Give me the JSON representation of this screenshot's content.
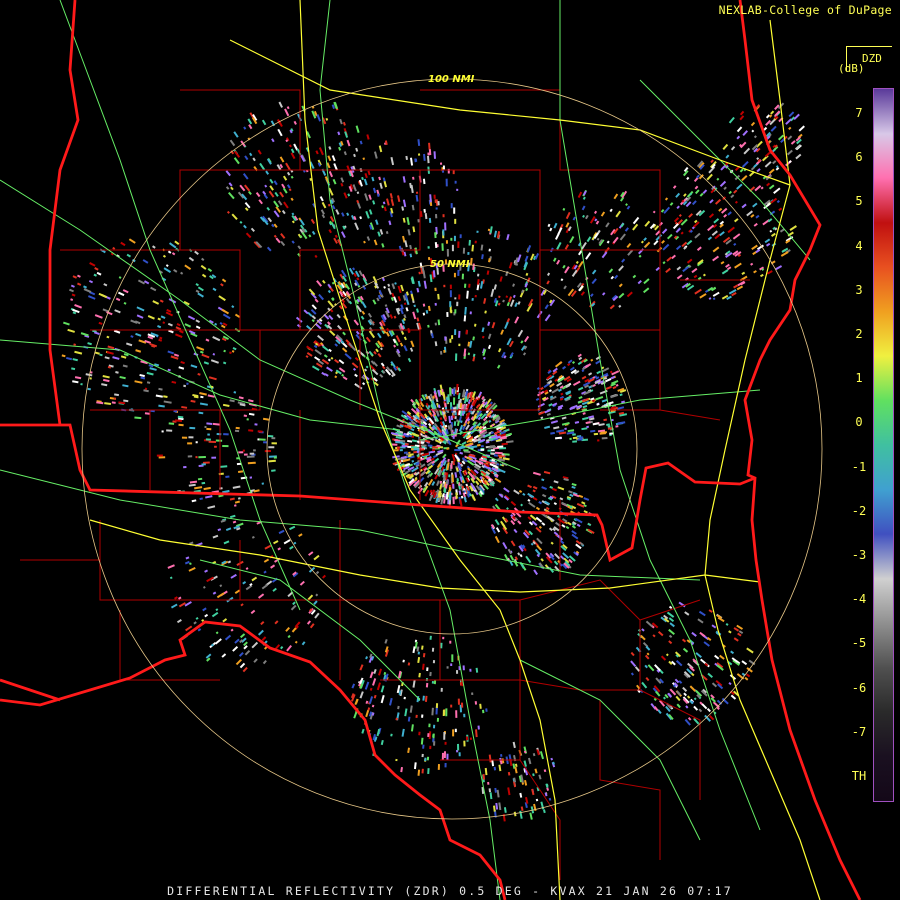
{
  "header": {
    "credit": "NEXLAB-College of DuPage"
  },
  "footer": {
    "product_line": "DIFFERENTIAL REFLECTIVITY (ZDR) 0.5 DEG - KVAX 21 JAN 26 07:17"
  },
  "map": {
    "radar_site": "KVAX",
    "range_rings": [
      {
        "label": "50 NMI"
      },
      {
        "label": "100 NMI"
      }
    ],
    "colors": {
      "state_borders": "#ff1a1a",
      "county_borders": "#b00000",
      "interstates": "#ffff33",
      "highways": "#66ee66",
      "range_rings": "#e8c888",
      "echo_palette": [
        "#7f7f7f",
        "#c8c8c8",
        "#3fb0d0",
        "#3050c8",
        "#40d0a0",
        "#60e060",
        "#e0e040",
        "#f0a020",
        "#e03020",
        "#c00000",
        "#ff70b0",
        "#ffffff",
        "#a070ff"
      ]
    }
  },
  "legend": {
    "product": "DZD",
    "units": "dB",
    "ticks": [
      "7",
      "6",
      "5",
      "4",
      "3",
      "2",
      "1",
      "0",
      "-1",
      "-2",
      "-3",
      "-4",
      "-5",
      "-6",
      "-7",
      "TH"
    ],
    "colorbar_stops": [
      "#5a3a9a",
      "#d8c8e8",
      "#ff70b0",
      "#c01010",
      "#e85020",
      "#f0a020",
      "#f0f040",
      "#60e060",
      "#40c0a0",
      "#40a0d0",
      "#4050c0",
      "#d0d0d0",
      "#909090",
      "#505050",
      "#2a2a2a",
      "#1a1020",
      "#140818"
    ]
  }
}
